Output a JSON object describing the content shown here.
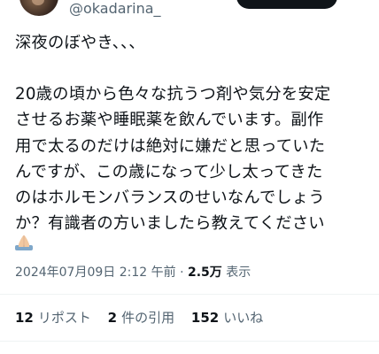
{
  "author": {
    "handle": "@okadarina_"
  },
  "tweet": {
    "line1": "深夜のぼやき、、、",
    "body_lines": [
      "20歳の頃から色々な抗うつ剤や気分を安定",
      "させるお薬や睡眠薬を飲んでいます。副作",
      "用で太るのだけは絶対に嫌だと思っていた",
      "んですが、この歳になって少し太ってきた",
      "のはホルモンバランスのせいなんでしょう",
      "か？有識者の方いましたら教えてください"
    ],
    "emoji": "folded-hands-icon"
  },
  "meta": {
    "timestamp": "2024年07月09日 2:12 午前",
    "separator": "·",
    "views_count": "2.5万",
    "views_label": "表示"
  },
  "stats": {
    "reposts_count": "12",
    "reposts_label": "リポスト",
    "quotes_count": "2",
    "quotes_label": "件の引用",
    "likes_count": "152",
    "likes_label": "いいね"
  },
  "colors": {
    "text": "#0f1419",
    "secondary": "#536471",
    "divider": "#eff3f4",
    "button": "#0f1419"
  }
}
